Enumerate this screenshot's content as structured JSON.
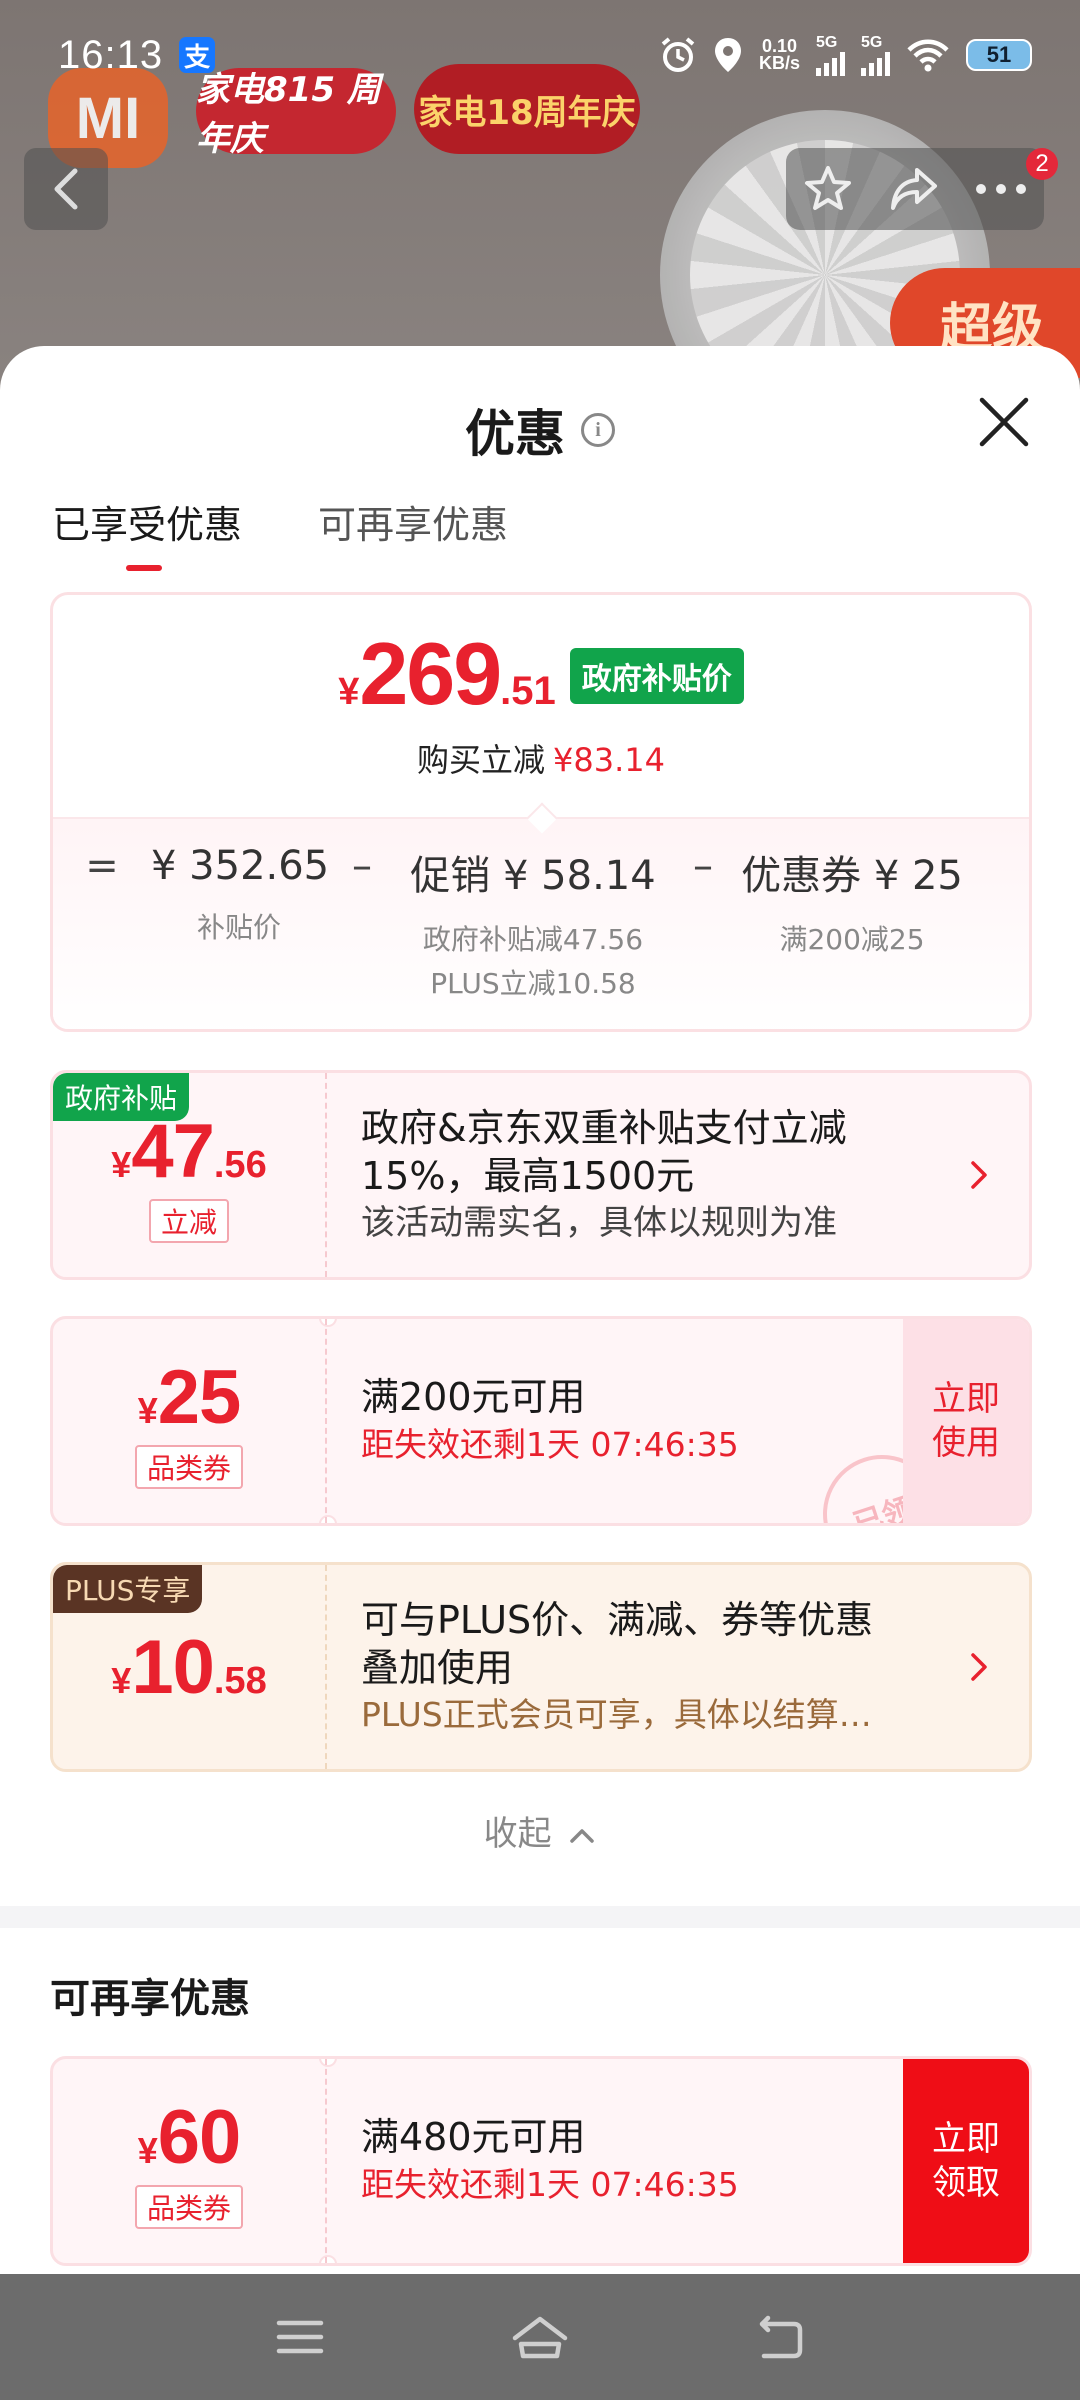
{
  "status_bar": {
    "time": "16:13",
    "alipay_icon": "支",
    "net_speed_top": "0.10",
    "net_speed_bottom": "KB/s",
    "sim1": "5G",
    "sim2": "5G",
    "battery": "51"
  },
  "background": {
    "brand_logo": "MI",
    "badge_1": "家电815 周年庆",
    "badge_2": "家电18周年庆",
    "cart_count": "2",
    "promo_strip": "超级"
  },
  "sheet": {
    "title": "优惠",
    "tabs": [
      {
        "label": "已享受优惠",
        "active": true
      },
      {
        "label": "可再享优惠",
        "active": false
      }
    ],
    "summary": {
      "currency": "¥",
      "price_int": "269",
      "price_dec": ".51",
      "price_tag": "政府补贴价",
      "cut_label": "购买立减",
      "cut_value": "¥83.14",
      "formula": {
        "eq": "=",
        "base_value": "¥ 352.65",
        "base_label": "补贴价",
        "minus1": "–",
        "promo_value": "促销 ¥ 58.14",
        "promo_sub1": "政府补贴减47.56",
        "promo_sub2": "PLUS立减10.58",
        "minus2": "–",
        "coupon_value": "优惠券 ¥ 25",
        "coupon_sub": "满200减25"
      }
    },
    "coupons": [
      {
        "corner": "政府补贴",
        "yen": "¥",
        "int": "47",
        "dec": ".56",
        "tag": "立减",
        "line1": "政府&京东双重补贴支付立减",
        "line2": "15%，最高1500元",
        "line3": "该活动需实名，具体以规则为准"
      },
      {
        "yen": "¥",
        "int": "25",
        "tag": "品类券",
        "line1": "满200元可用",
        "line2": "距失效还剩1天 07:46:35",
        "action": "立即使用",
        "stamp": "已领"
      },
      {
        "corner": "PLUS专享",
        "yen": "¥",
        "int": "10",
        "dec": ".58",
        "line1": "可与PLUS价、满减、券等优惠",
        "line2": "叠加使用",
        "line3": "PLUS正式会员可享，具体以结算…"
      }
    ],
    "collapse_label": "收起",
    "more_section_title": "可再享优惠",
    "more_coupons": [
      {
        "yen": "¥",
        "int": "60",
        "tag": "品类券",
        "line1": "满480元可用",
        "line2": "距失效还剩1天 07:46:35",
        "action": "立即领取"
      }
    ]
  },
  "colors": {
    "accent_red": "#e8212e",
    "gov_green": "#11a44b",
    "plus_brown": "#5a3424"
  },
  "icons": [
    "back-icon",
    "star-icon",
    "share-icon",
    "more-icon",
    "info-icon",
    "close-icon",
    "chevron-right-icon",
    "chevron-up-icon",
    "menu-icon",
    "home-icon",
    "return-icon"
  ]
}
